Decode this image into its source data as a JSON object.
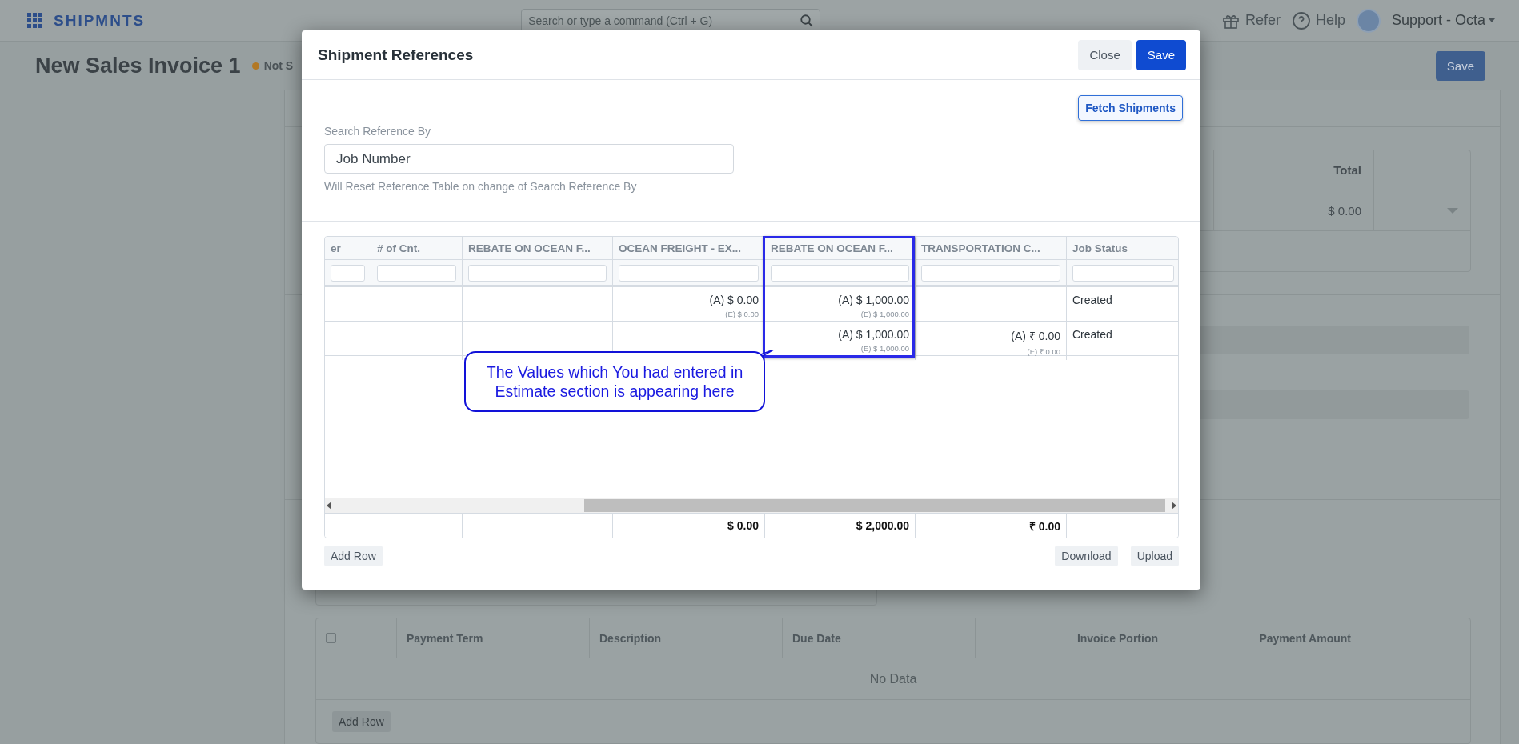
{
  "app": {
    "brand": "SHIPMNTS",
    "search_placeholder": "Search or type a command (Ctrl + G)",
    "nav": [
      {
        "label": "Refer",
        "kind": "gift"
      },
      {
        "label": "Help",
        "kind": "help"
      }
    ],
    "user": "Support - Octa"
  },
  "page": {
    "title": "New Sales Invoice 1",
    "status": "Not S",
    "save": "Save"
  },
  "background": {
    "items_table": {
      "column": "Total",
      "value": "$ 0.00"
    },
    "payment_table": {
      "select_all_checked": false,
      "columns": [
        "Payment Term",
        "Description",
        "Due Date",
        "Invoice Portion",
        "Payment Amount"
      ],
      "empty": "No Data",
      "add_row": "Add Row"
    }
  },
  "modal": {
    "title": "Shipment References",
    "buttons": [
      {
        "label": "Close",
        "kind": "secondary"
      },
      {
        "label": "Save",
        "kind": "primary"
      }
    ],
    "fetch": "Fetch Shipments",
    "field": {
      "label": "Search Reference By",
      "value": "Job Number",
      "help": "Will Reset Reference Table on change of Search Reference By"
    },
    "table": {
      "columns": [
        {
          "label": "er",
          "highlighted": false
        },
        {
          "label": "# of Cnt.",
          "highlighted": false
        },
        {
          "label": "REBATE ON OCEAN F...",
          "highlighted": false
        },
        {
          "label": "OCEAN FREIGHT - EX...",
          "highlighted": false,
          "total": "$ 0.00"
        },
        {
          "label": "REBATE ON OCEAN F...",
          "highlighted": true,
          "total": "$ 2,000.00"
        },
        {
          "label": "TRANSPORTATION C...",
          "highlighted": false,
          "total": "₹ 0.00"
        },
        {
          "label": "Job Status",
          "highlighted": false
        }
      ],
      "rows": [
        [
          null,
          null,
          null,
          {
            "actual": "(A) $ 0.00",
            "estimate": "(E) $ 0.00"
          },
          {
            "actual": "(A) $ 1,000.00",
            "estimate": "(E) $ 1,000.00"
          },
          null,
          "Created"
        ],
        [
          null,
          null,
          null,
          null,
          {
            "actual": "(A) $ 1,000.00",
            "estimate": "(E) $ 1,000.00"
          },
          {
            "actual": "(A) ₹ 0.00",
            "estimate": "(E) ₹ 0.00"
          },
          "Created"
        ]
      ]
    },
    "callout": "The Values which You had entered in Estimate section is appearing here",
    "left_buttons": [
      "Add Row"
    ],
    "right_buttons": [
      "Download",
      "Upload"
    ]
  }
}
